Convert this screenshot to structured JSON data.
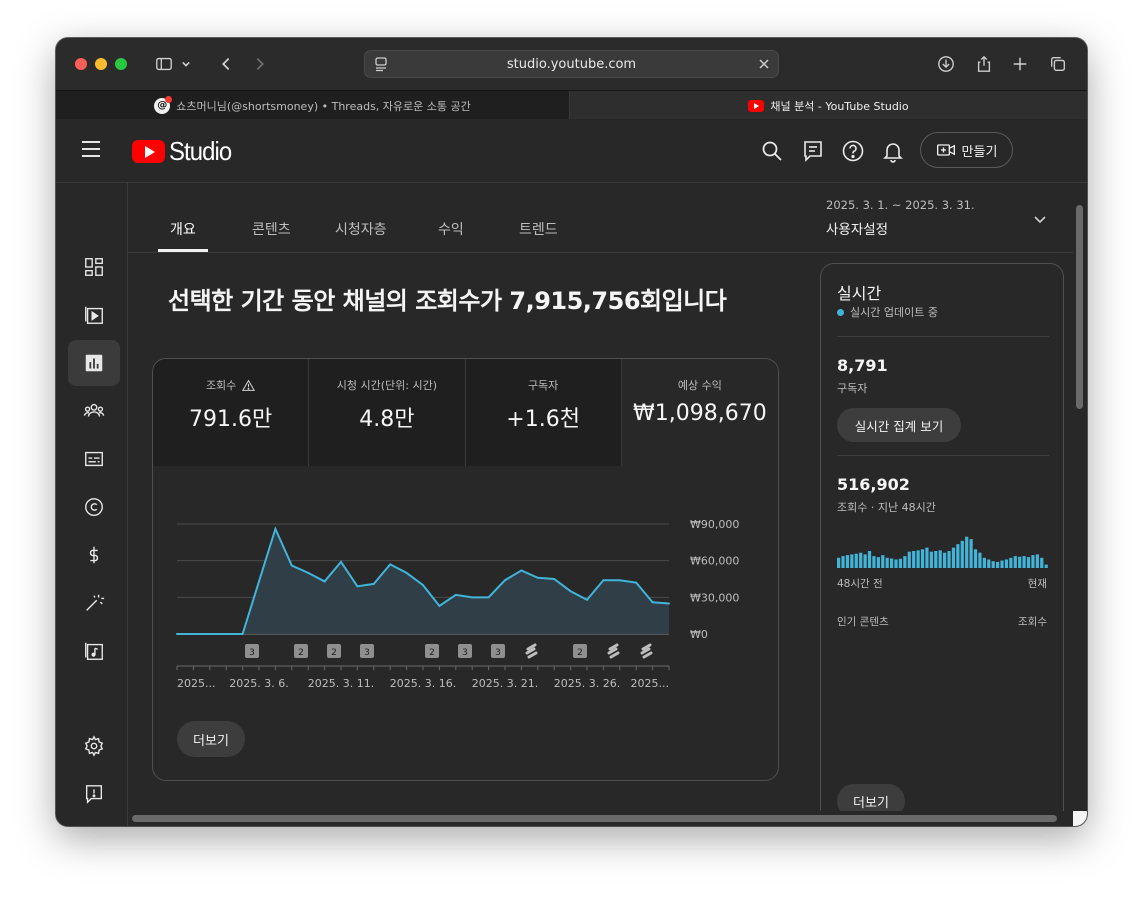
{
  "browser": {
    "url": "studio.youtube.com",
    "tabs": [
      {
        "title": "쇼츠머니님(@shortsmoney) • Threads, 자유로운 소통 공간",
        "active": false
      },
      {
        "title": "채널 분석 - YouTube Studio",
        "active": true
      }
    ]
  },
  "header": {
    "logo_text": "Studio",
    "create_label": "만들기"
  },
  "subtabs": [
    "개요",
    "콘텐츠",
    "시청자층",
    "수익",
    "트렌드"
  ],
  "date_range": {
    "range": "2025. 3. 1. ~ 2025. 3. 31.",
    "label": "사용자설정"
  },
  "headline": "선택한 기간 동안 채널의 조회수가 7,915,756회입니다",
  "metrics": [
    {
      "label": "조회수",
      "value": "791.6만",
      "warning": true
    },
    {
      "label": "시청 시간(단위: 시간)",
      "value": "4.8만"
    },
    {
      "label": "구독자",
      "value": "+1.6천"
    },
    {
      "label": "예상 수익",
      "value": "₩1,098,670"
    }
  ],
  "more_label": "더보기",
  "chart_data": {
    "type": "area",
    "title": "",
    "ylabel": "예상 수익",
    "ylim": [
      0,
      90000
    ],
    "y_ticks": [
      "₩90,000",
      "₩60,000",
      "₩30,000",
      "₩0"
    ],
    "y_tick_values": [
      90000,
      60000,
      30000,
      0
    ],
    "x_tick_labels": [
      "2025...",
      "2025. 3. 6.",
      "2025. 3. 11.",
      "2025. 3. 16.",
      "2025. 3. 21.",
      "2025. 3. 26.",
      "2025..."
    ],
    "x": [
      "3/1",
      "3/2",
      "3/3",
      "3/4",
      "3/5",
      "3/6",
      "3/7",
      "3/8",
      "3/9",
      "3/10",
      "3/11",
      "3/12",
      "3/13",
      "3/14",
      "3/15",
      "3/16",
      "3/17",
      "3/18",
      "3/19",
      "3/20",
      "3/21",
      "3/22",
      "3/23",
      "3/24",
      "3/25",
      "3/26",
      "3/27",
      "3/28",
      "3/29",
      "3/30",
      "3/31"
    ],
    "series": [
      {
        "values": [
          0,
          0,
          0,
          0,
          0,
          43000,
          86000,
          56000,
          50000,
          43000,
          59000,
          39000,
          41000,
          57000,
          50000,
          40000,
          23000,
          32000,
          30000,
          30000,
          44000,
          52000,
          46000,
          45000,
          35000,
          28000,
          44000,
          44000,
          42000,
          26000,
          25000
        ]
      }
    ],
    "markers": [
      {
        "date": "3/6",
        "label": "3"
      },
      {
        "date": "3/10",
        "label": "2"
      },
      {
        "date": "3/12",
        "label": "2"
      },
      {
        "date": "3/14",
        "label": "3"
      },
      {
        "date": "3/20",
        "label": "2"
      },
      {
        "date": "3/22",
        "label": "3"
      },
      {
        "date": "3/24",
        "label": "3"
      },
      {
        "date": "3/26",
        "label": "shorts"
      },
      {
        "date": "3/29",
        "label": "2"
      },
      {
        "date": "3/31",
        "label": "shorts"
      },
      {
        "date": "3/31b",
        "label": "shorts"
      }
    ],
    "line_color": "#41b4d8",
    "fill_color": "#2f3e47"
  },
  "realtime": {
    "title": "실시간",
    "live_text": "실시간 업데이트 중",
    "subscribers_value": "8,791",
    "subscribers_label": "구독자",
    "realtime_button": "실시간 집계 보기",
    "views_value": "516,902",
    "views_label": "조회수 · 지난 48시간",
    "axis_left": "48시간 전",
    "axis_right": "현재",
    "top_content_label": "인기 콘텐츠",
    "top_content_metric": "조회수",
    "more_label": "더보기",
    "bar_color": "#41b4d8",
    "bars": [
      0.3,
      0.35,
      0.38,
      0.4,
      0.42,
      0.45,
      0.4,
      0.5,
      0.35,
      0.32,
      0.38,
      0.3,
      0.28,
      0.25,
      0.27,
      0.35,
      0.48,
      0.5,
      0.52,
      0.55,
      0.6,
      0.48,
      0.5,
      0.52,
      0.45,
      0.5,
      0.6,
      0.7,
      0.8,
      0.92,
      0.85,
      0.55,
      0.45,
      0.3,
      0.25,
      0.2,
      0.18,
      0.22,
      0.25,
      0.3,
      0.35,
      0.33,
      0.35,
      0.32,
      0.38,
      0.4,
      0.3,
      0.1
    ]
  }
}
